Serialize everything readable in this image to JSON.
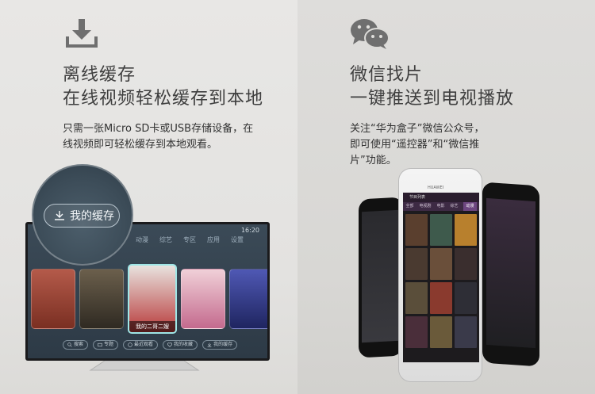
{
  "left": {
    "title_line1": "离线缓存",
    "title_line2": "在线视频轻松缓存到本地",
    "desc_line1": "只需一张Micro   SD卡或USB存储设备，在",
    "desc_line2": "线视频即可轻松缓存到本地观看。",
    "icon": "download-icon",
    "magnifier_label": "我的缓存"
  },
  "right": {
    "title_line1": "微信找片",
    "title_line2": "一键推送到电视播放",
    "desc_line1": "关注“华为盒子”微信公众号，",
    "desc_line2": "即可使用“遥控器”和“微信推",
    "desc_line3": "片”功能。",
    "icon": "wechat-icon"
  },
  "tv": {
    "clock": "16:20",
    "nav_tabs": [
      "动漫",
      "综艺",
      "专区",
      "应用",
      "设置"
    ],
    "featured_card_caption": "我的二哥二嫂",
    "bottom_buttons": [
      "搜索",
      "专题",
      "最近观看",
      "我的收藏",
      "我的缓存"
    ]
  },
  "phone": {
    "brand": "HUAWEI",
    "topbar": "节目列表",
    "tabs": [
      "全部",
      "电视剧",
      "电影",
      "综艺",
      "动漫"
    ],
    "active_tab": "动漫",
    "posters": [
      "",
      "",
      "",
      "",
      "",
      "",
      "",
      "",
      "",
      "",
      "",
      ""
    ]
  },
  "colors": {
    "bg_left": "#e8e7e5",
    "bg_right": "#dcdbd8",
    "title_text": "#3f3f3f",
    "icon": "#6f6f6f",
    "tv_screen": "#33424f",
    "phone_accent": "#6d4680"
  }
}
